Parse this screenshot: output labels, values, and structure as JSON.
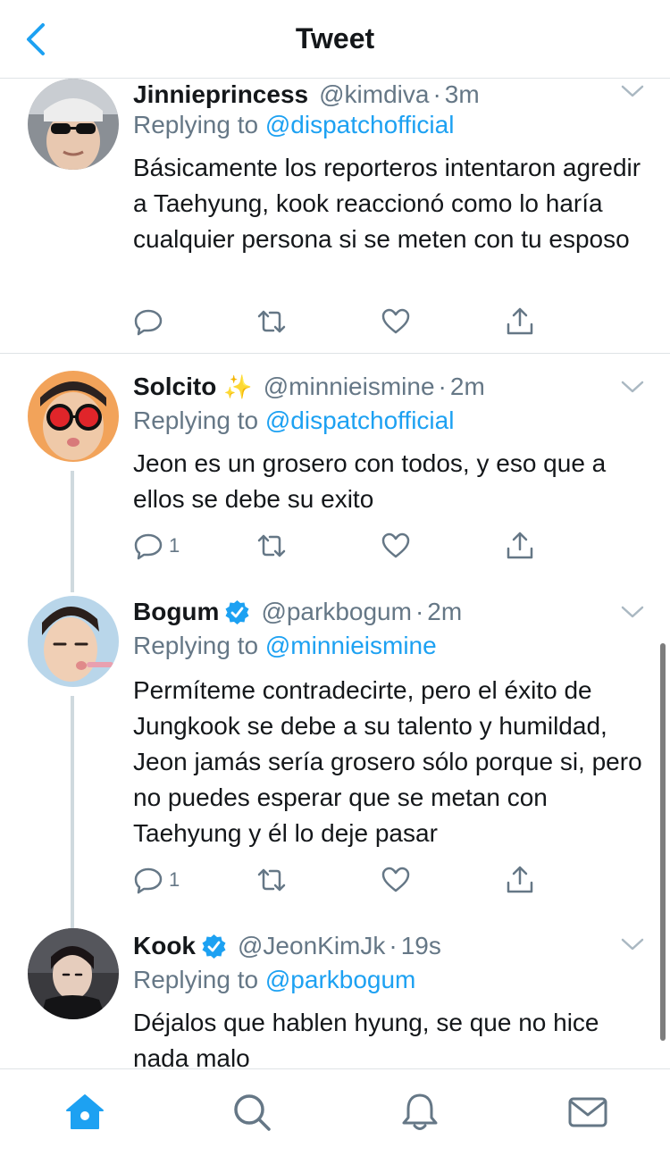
{
  "header": {
    "title": "Tweet"
  },
  "tweets": [
    {
      "name": "Jinnieprincess",
      "handle": "@kimdiva",
      "dot": "·",
      "time": "3m",
      "reply_prefix": "Replying to ",
      "reply_to": "@dispatchofficial",
      "text": "Básicamente los reporteros intentaron agredir a Taehyung, kook reaccionó como lo haría cualquier persona si se meten con tu esposo",
      "reply_count": ""
    },
    {
      "name": "Solcito",
      "emoji": "✨",
      "handle": "@minnieismine",
      "dot": "·",
      "time": "2m",
      "reply_prefix": "Replying to ",
      "reply_to": "@dispatchofficial",
      "text": "Jeon es un grosero con todos, y eso que a ellos se debe su exito",
      "reply_count": "1"
    },
    {
      "name": "Bogum",
      "handle": "@parkbogum",
      "dot": "·",
      "time": "2m",
      "reply_prefix": "Replying to ",
      "reply_to": "@minnieismine",
      "text": "Permíteme contradecirte, pero el éxito de Jungkook se debe a su talento y humildad, Jeon jamás sería grosero sólo porque si, pero no puedes esperar que se metan con Taehyung y él lo deje pasar",
      "reply_count": "1"
    },
    {
      "name": "Kook",
      "handle": "@JeonKimJk",
      "dot": "·",
      "time": "19s",
      "reply_prefix": "Replying to ",
      "reply_to": "@parkbogum",
      "text": "Déjalos que hablen hyung, se que no hice nada malo",
      "reply_count": ""
    }
  ],
  "icons": {
    "back": "chevron-left-icon",
    "reply": "reply-bubble-icon",
    "retweet": "retweet-icon",
    "like": "heart-icon",
    "share": "share-icon",
    "verified": "verified-badge-icon",
    "tabs": [
      "home-icon",
      "search-icon",
      "bell-icon",
      "mail-icon"
    ]
  },
  "colors": {
    "accent": "#1da1f2",
    "secondary_text": "#657786",
    "primary_text": "#14171a",
    "separator": "#dfe3e6"
  }
}
